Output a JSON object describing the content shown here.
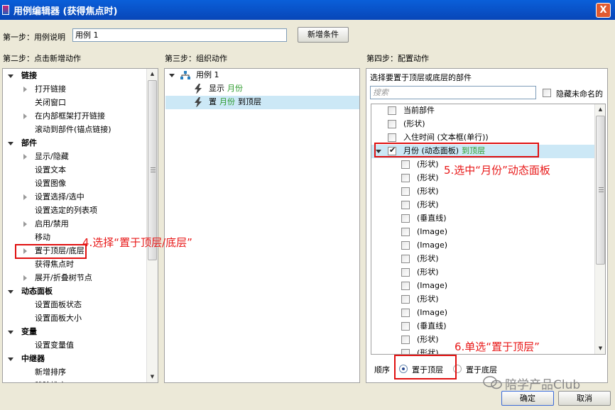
{
  "window": {
    "title": "用例编辑器 (获得焦点时)",
    "close_glyph": "X"
  },
  "step1": {
    "label": "第一步：用例说明",
    "case_name": "用例 1",
    "add_condition": "新增条件"
  },
  "step2": {
    "label": "第二步：点击新增动作",
    "items": [
      {
        "text": "链接",
        "kind": "cat"
      },
      {
        "text": "打开链接",
        "kind": "expand"
      },
      {
        "text": "关闭窗口",
        "kind": "leaf"
      },
      {
        "text": "在内部框架打开链接",
        "kind": "expand"
      },
      {
        "text": "滚动到部件(锚点链接)",
        "kind": "leaf"
      },
      {
        "text": "部件",
        "kind": "cat"
      },
      {
        "text": "显示/隐藏",
        "kind": "expand"
      },
      {
        "text": "设置文本",
        "kind": "leaf"
      },
      {
        "text": "设置图像",
        "kind": "leaf"
      },
      {
        "text": "设置选择/选中",
        "kind": "expand"
      },
      {
        "text": "设置选定的列表项",
        "kind": "leaf"
      },
      {
        "text": "启用/禁用",
        "kind": "expand"
      },
      {
        "text": "移动",
        "kind": "leaf"
      },
      {
        "text": "置于顶层/底层",
        "kind": "expand"
      },
      {
        "text": "获得焦点时",
        "kind": "leaf"
      },
      {
        "text": "展开/折叠树节点",
        "kind": "expand"
      },
      {
        "text": "动态面板",
        "kind": "cat"
      },
      {
        "text": "设置面板状态",
        "kind": "leaf"
      },
      {
        "text": "设置面板大小",
        "kind": "leaf"
      },
      {
        "text": "变量",
        "kind": "cat"
      },
      {
        "text": "设置变量值",
        "kind": "leaf"
      },
      {
        "text": "中继器",
        "kind": "cat"
      },
      {
        "text": "新增排序",
        "kind": "leaf"
      },
      {
        "text": "移除排序",
        "kind": "leaf"
      }
    ]
  },
  "step3": {
    "label": "第三步：组织动作",
    "case": "用例 1",
    "actions": [
      {
        "verb": "显示",
        "target": "月份",
        "suffix": ""
      },
      {
        "verb": "置",
        "target": "月份",
        "suffix": "到顶层"
      }
    ]
  },
  "step4": {
    "label": "第四步：配置动作",
    "prompt": "选择要置于顶层或底层的部件",
    "search_placeholder": "搜索",
    "hide_unnamed": "隐藏未命名的",
    "widgets": [
      {
        "text": "当前部件",
        "checked": false,
        "indent": 0
      },
      {
        "text": "(形状)",
        "checked": false,
        "indent": 0
      },
      {
        "text": "入住时间 (文本框(单行))",
        "checked": false,
        "indent": 0
      },
      {
        "text": "月份 (动态面板)",
        "extra": "到顶层",
        "checked": true,
        "indent": 0,
        "selected": true
      },
      {
        "text": "(形状)",
        "checked": false,
        "indent": 1
      },
      {
        "text": "(形状)",
        "checked": false,
        "indent": 1
      },
      {
        "text": "(形状)",
        "checked": false,
        "indent": 1
      },
      {
        "text": "(形状)",
        "checked": false,
        "indent": 1
      },
      {
        "text": "(垂直线)",
        "checked": false,
        "indent": 1
      },
      {
        "text": "(Image)",
        "checked": false,
        "indent": 1
      },
      {
        "text": "(Image)",
        "checked": false,
        "indent": 1
      },
      {
        "text": "(形状)",
        "checked": false,
        "indent": 1
      },
      {
        "text": "(形状)",
        "checked": false,
        "indent": 1
      },
      {
        "text": "(Image)",
        "checked": false,
        "indent": 1
      },
      {
        "text": "(形状)",
        "checked": false,
        "indent": 1
      },
      {
        "text": "(Image)",
        "checked": false,
        "indent": 1
      },
      {
        "text": "(垂直线)",
        "checked": false,
        "indent": 1
      },
      {
        "text": "(形状)",
        "checked": false,
        "indent": 1
      },
      {
        "text": "(形状)",
        "checked": false,
        "indent": 1
      }
    ],
    "order_label": "顺序",
    "order_options": [
      "置于顶层",
      "置于底层"
    ],
    "order_selected": "置于顶层"
  },
  "annotations": {
    "a4": "4.选择“置于顶层/底层”",
    "a5": "5.选中“月份”动态面板",
    "a6": "6.单选“置于顶层”"
  },
  "watermark": "陪学产品Club",
  "footer": {
    "ok": "确定",
    "cancel": "取消"
  },
  "colors": {
    "annotation": "#e01010",
    "selection": "#cce8f6",
    "green_text": "#2a9a2a"
  }
}
